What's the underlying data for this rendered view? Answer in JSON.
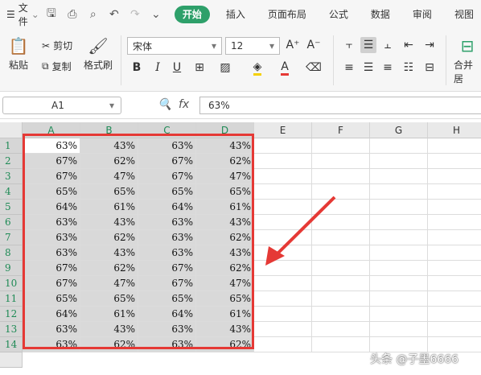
{
  "menubar": {
    "file_label": "文件",
    "tabs": [
      "开始",
      "插入",
      "页面布局",
      "公式",
      "数据",
      "审阅",
      "视图"
    ]
  },
  "ribbon": {
    "paste_label": "粘贴",
    "cut_label": "剪切",
    "copy_label": "复制",
    "format_painter_label": "格式刷",
    "font_name": "宋体",
    "font_size": "12",
    "merge_label": "合并居"
  },
  "formula_bar": {
    "cell_ref": "A1",
    "fx_label": "fx",
    "formula_value": "63%"
  },
  "sheet": {
    "columns": [
      "A",
      "B",
      "C",
      "D",
      "E",
      "F",
      "G",
      "H"
    ],
    "rows": [
      [
        "63%",
        "43%",
        "63%",
        "43%"
      ],
      [
        "67%",
        "62%",
        "67%",
        "62%"
      ],
      [
        "67%",
        "47%",
        "67%",
        "47%"
      ],
      [
        "65%",
        "65%",
        "65%",
        "65%"
      ],
      [
        "64%",
        "61%",
        "64%",
        "61%"
      ],
      [
        "63%",
        "43%",
        "63%",
        "43%"
      ],
      [
        "63%",
        "62%",
        "63%",
        "62%"
      ],
      [
        "63%",
        "43%",
        "63%",
        "43%"
      ],
      [
        "67%",
        "62%",
        "67%",
        "62%"
      ],
      [
        "67%",
        "47%",
        "67%",
        "47%"
      ],
      [
        "65%",
        "65%",
        "65%",
        "65%"
      ],
      [
        "64%",
        "61%",
        "64%",
        "61%"
      ],
      [
        "63%",
        "43%",
        "63%",
        "43%"
      ],
      [
        "63%",
        "62%",
        "63%",
        "62%"
      ]
    ]
  },
  "watermark": "头条 @子墨6666",
  "colors": {
    "accent_green": "#2ea06a",
    "selection_border": "#e53935",
    "arrow": "#e53935"
  }
}
